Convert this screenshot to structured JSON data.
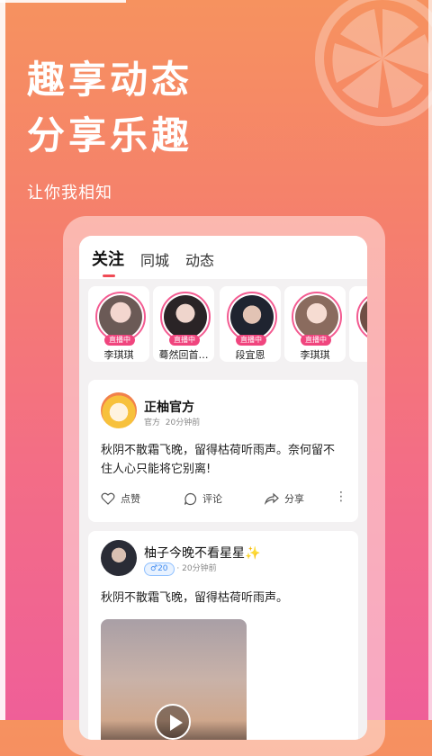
{
  "promo": {
    "headline_line1": "趣享动态",
    "headline_line2": "分享乐趣",
    "subtitle": "让你我相知"
  },
  "tabs": [
    {
      "label": "关注",
      "active": true
    },
    {
      "label": "同城",
      "active": false
    },
    {
      "label": "动态",
      "active": false
    }
  ],
  "stories": [
    {
      "name": "李琪琪",
      "badge": "直播中"
    },
    {
      "name": "蓦然回首…",
      "badge": "直播中"
    },
    {
      "name": "段宜恩",
      "badge": "直播中"
    },
    {
      "name": "李琪琪",
      "badge": "直播中"
    },
    {
      "name": "",
      "badge": ""
    }
  ],
  "posts": [
    {
      "user": "正柚官方",
      "tag": "官方",
      "time": "20分钟前",
      "text": "秋阴不散霜飞晚，留得枯荷听雨声。奈何留不住人心只能将它别离!",
      "like_label": "点赞",
      "comment_label": "评论",
      "share_label": "分享"
    },
    {
      "user": "柚子今晚不看星星✨",
      "level": "♂20",
      "dot": "·",
      "time": "20分钟前",
      "text": "秋阴不散霜飞晚，留得枯荷听雨声。"
    }
  ],
  "colors": {
    "accent": "#f04a55",
    "live": "#f0457e",
    "ring": "#f35b91"
  }
}
